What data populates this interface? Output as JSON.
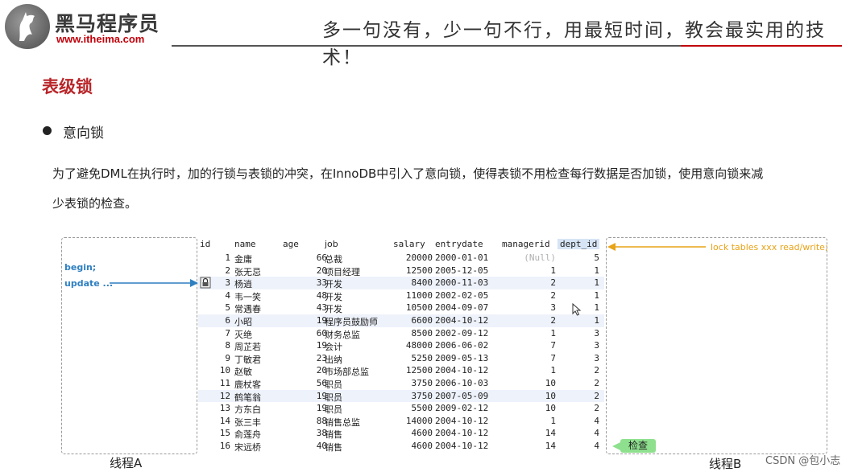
{
  "header": {
    "brand_name": "黑马程序员",
    "brand_url": "www.itheima.com",
    "slogan": "多一句没有，少一句不行，用最短时间，教会最实用的技术！"
  },
  "section_title": "表级锁",
  "bullet_text": "意向锁",
  "paragraph_line1": "为了避免DML在执行时，加的行锁与表锁的冲突，在InnoDB中引入了意向锁，使得表锁不用检查每行数据是否加锁，使用意向锁来减",
  "paragraph_line2": "少表锁的检查。",
  "thread_a": {
    "label": "线程A",
    "begin": "begin;",
    "update": "update ..."
  },
  "thread_b": {
    "label": "线程B",
    "lock_command": "lock tables xxx read/write;",
    "check_label": "检查"
  },
  "watermark": "CSDN @包小志",
  "table": {
    "columns": [
      "id",
      "name",
      "age",
      "job",
      "salary",
      "entrydate",
      "managerid",
      "dept_id"
    ],
    "rows": [
      {
        "id": "1",
        "name": "金庸",
        "age": "66",
        "job": "总裁",
        "salary": "20000",
        "entrydate": "2000-01-01",
        "managerid": "(Null)",
        "dept_id": "5"
      },
      {
        "id": "2",
        "name": "张无忌",
        "age": "20",
        "job": "项目经理",
        "salary": "12500",
        "entrydate": "2005-12-05",
        "managerid": "1",
        "dept_id": "1"
      },
      {
        "id": "3",
        "name": "杨逍",
        "age": "33",
        "job": "开发",
        "salary": "8400",
        "entrydate": "2000-11-03",
        "managerid": "2",
        "dept_id": "1"
      },
      {
        "id": "4",
        "name": "韦一笑",
        "age": "48",
        "job": "开发",
        "salary": "11000",
        "entrydate": "2002-02-05",
        "managerid": "2",
        "dept_id": "1"
      },
      {
        "id": "5",
        "name": "常遇春",
        "age": "43",
        "job": "开发",
        "salary": "10500",
        "entrydate": "2004-09-07",
        "managerid": "3",
        "dept_id": "1"
      },
      {
        "id": "6",
        "name": "小昭",
        "age": "19",
        "job": "程序员鼓励师",
        "salary": "6600",
        "entrydate": "2004-10-12",
        "managerid": "2",
        "dept_id": "1"
      },
      {
        "id": "7",
        "name": "灭绝",
        "age": "60",
        "job": "财务总监",
        "salary": "8500",
        "entrydate": "2002-09-12",
        "managerid": "1",
        "dept_id": "3"
      },
      {
        "id": "8",
        "name": "周芷若",
        "age": "19",
        "job": "会计",
        "salary": "48000",
        "entrydate": "2006-06-02",
        "managerid": "7",
        "dept_id": "3"
      },
      {
        "id": "9",
        "name": "丁敏君",
        "age": "23",
        "job": "出纳",
        "salary": "5250",
        "entrydate": "2009-05-13",
        "managerid": "7",
        "dept_id": "3"
      },
      {
        "id": "10",
        "name": "赵敏",
        "age": "20",
        "job": "市场部总监",
        "salary": "12500",
        "entrydate": "2004-10-12",
        "managerid": "1",
        "dept_id": "2"
      },
      {
        "id": "11",
        "name": "鹿杖客",
        "age": "56",
        "job": "职员",
        "salary": "3750",
        "entrydate": "2006-10-03",
        "managerid": "10",
        "dept_id": "2"
      },
      {
        "id": "12",
        "name": "鹤笔翁",
        "age": "19",
        "job": "职员",
        "salary": "3750",
        "entrydate": "2007-05-09",
        "managerid": "10",
        "dept_id": "2"
      },
      {
        "id": "13",
        "name": "方东白",
        "age": "19",
        "job": "职员",
        "salary": "5500",
        "entrydate": "2009-02-12",
        "managerid": "10",
        "dept_id": "2"
      },
      {
        "id": "14",
        "name": "张三丰",
        "age": "88",
        "job": "销售总监",
        "salary": "14000",
        "entrydate": "2004-10-12",
        "managerid": "1",
        "dept_id": "4"
      },
      {
        "id": "15",
        "name": "俞莲舟",
        "age": "38",
        "job": "销售",
        "salary": "4600",
        "entrydate": "2004-10-12",
        "managerid": "14",
        "dept_id": "4"
      },
      {
        "id": "16",
        "name": "宋远桥",
        "age": "40",
        "job": "销售",
        "salary": "4600",
        "entrydate": "2004-10-12",
        "managerid": "14",
        "dept_id": "4"
      }
    ]
  },
  "colors": {
    "title_red": "#b8262a",
    "thread_a_blue": "#2e7fc1",
    "thread_b_orange": "#e8a317",
    "check_green": "#8ee08e"
  }
}
